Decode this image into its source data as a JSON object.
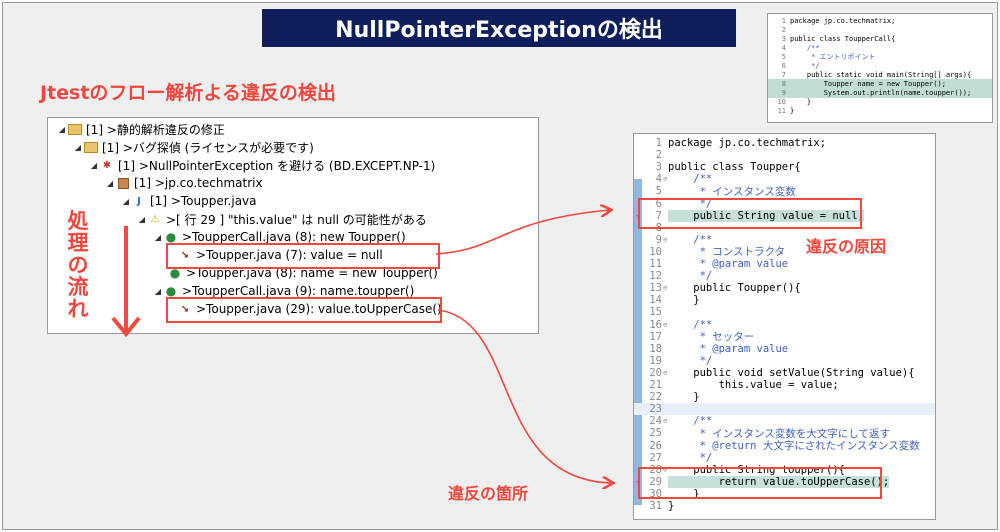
{
  "title": "NullPointerExceptionの検出",
  "heading": "Jtestのフロー解析よる違反の検出",
  "flow_label": [
    "処",
    "理",
    "の",
    "流",
    "れ"
  ],
  "callouts": {
    "cause": "違反の原因",
    "location": "違反の箇所"
  },
  "tree": [
    {
      "icon": "folder-icon",
      "text": "[1] >静的解析違反の修正"
    },
    {
      "icon": "folder-icon",
      "text": "[1] >バグ探偵 (ライセンスが必要です)"
    },
    {
      "icon": "bug-icon",
      "text": "[1] >NullPointerException を避ける (BD.EXCEPT.NP-1)"
    },
    {
      "icon": "package-icon",
      "text": "[1] >jp.co.techmatrix"
    },
    {
      "icon": "java-file-icon",
      "text": "[1] >Toupper.java"
    },
    {
      "icon": "warning-icon",
      "text": ">[ 行 29 ] \"this.value\" は null の可能性がある"
    },
    {
      "icon": "flow-point-icon",
      "text": ">ToupperCall.java (8): new Toupper()"
    },
    {
      "icon": "violation-cause-icon",
      "text": ">Toupper.java (7): value = null"
    },
    {
      "icon": "flow-point-icon",
      "text": ">Toupper.java (8): name = new Toupper()"
    },
    {
      "icon": "flow-point-icon",
      "text": ">ToupperCall.java (9): name.toupper()"
    },
    {
      "icon": "violation-point-icon",
      "text": ">Toupper.java (29): value.toUpperCase()"
    }
  ],
  "small_code": [
    {
      "num": "1",
      "text": "package jp.co.techmatrix;"
    },
    {
      "num": "2",
      "text": ""
    },
    {
      "num": "3",
      "text": "public class ToupperCall{"
    },
    {
      "num": "4",
      "text": "    /**"
    },
    {
      "num": "5",
      "text": "     * エントリポイント"
    },
    {
      "num": "6",
      "text": "     */"
    },
    {
      "num": "7",
      "text": "    public static void main(String[] args){"
    },
    {
      "num": "8",
      "text": "        Toupper name = new Toupper();"
    },
    {
      "num": "9",
      "text": "        System.out.println(name.toupper());"
    },
    {
      "num": "10",
      "text": "    }"
    },
    {
      "num": "11",
      "text": "}"
    }
  ],
  "code": [
    {
      "num": "1",
      "text": "package jp.co.techmatrix;"
    },
    {
      "num": "2",
      "text": ""
    },
    {
      "num": "3",
      "text": "public class Toupper{"
    },
    {
      "num": "4",
      "text": "    /**"
    },
    {
      "num": "5",
      "text": "     * インスタンス変数"
    },
    {
      "num": "6",
      "text": "     */"
    },
    {
      "num": "7",
      "text": "    public String value = null;"
    },
    {
      "num": "8",
      "text": ""
    },
    {
      "num": "9",
      "text": "    /**"
    },
    {
      "num": "10",
      "text": "     * コンストラクタ"
    },
    {
      "num": "11",
      "text": "     * @param value"
    },
    {
      "num": "12",
      "text": "     */"
    },
    {
      "num": "13",
      "text": "    public Toupper(){"
    },
    {
      "num": "14",
      "text": "    }"
    },
    {
      "num": "15",
      "text": ""
    },
    {
      "num": "16",
      "text": "    /**"
    },
    {
      "num": "17",
      "text": "     * セッター"
    },
    {
      "num": "18",
      "text": "     * @param value"
    },
    {
      "num": "19",
      "text": "     */"
    },
    {
      "num": "20",
      "text": "    public void setValue(String value){"
    },
    {
      "num": "21",
      "text": "        this.value = value;"
    },
    {
      "num": "22",
      "text": "    }"
    },
    {
      "num": "23",
      "text": ""
    },
    {
      "num": "24",
      "text": "    /**"
    },
    {
      "num": "25",
      "text": "     * インスタンス変数を大文字にして返す"
    },
    {
      "num": "26",
      "text": "     * @return 大文字にされたインスタンス変数"
    },
    {
      "num": "27",
      "text": "     */"
    },
    {
      "num": "28",
      "text": "    public String toupper(){"
    },
    {
      "num": "29",
      "text": "        return value.toUpperCase();"
    },
    {
      "num": "30",
      "text": "    }"
    },
    {
      "num": "31",
      "text": "}"
    }
  ],
  "colors": {
    "banner": "#0f1f5c",
    "accent_red": "#f0483e",
    "highlight": "#c8e0db",
    "gutter": "#8fb7e0"
  }
}
